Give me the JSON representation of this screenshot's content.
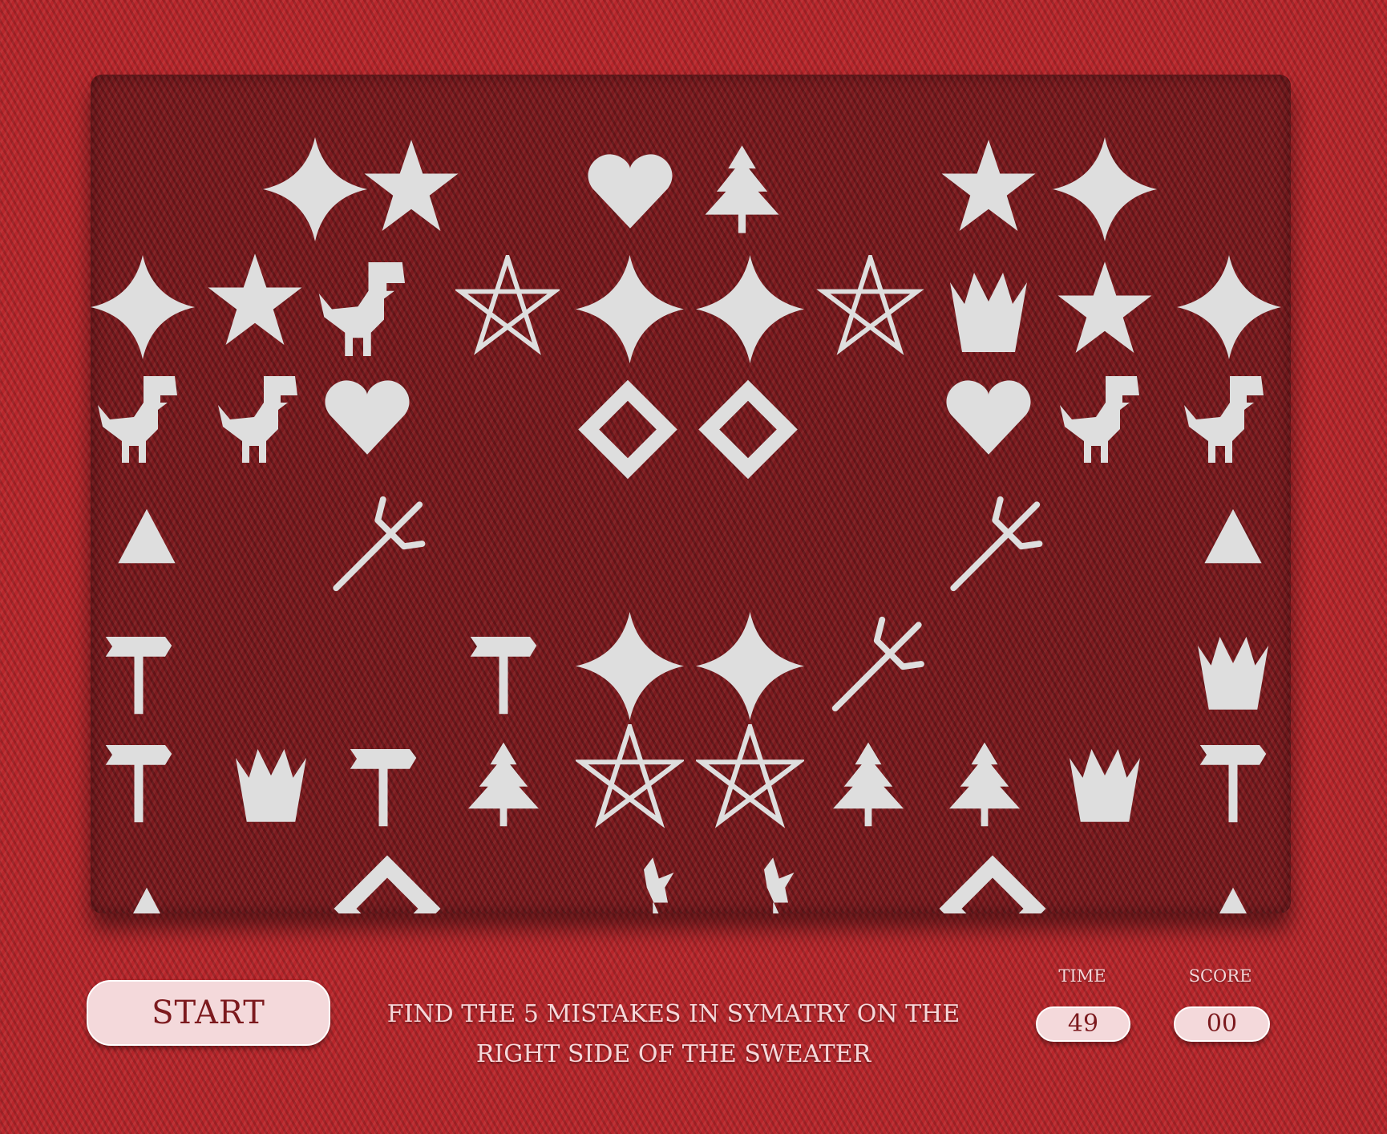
{
  "controls": {
    "start_label": "START"
  },
  "instructions": {
    "line1": "FIND THE 5 MISTAKES IN SYMATRY ON THE",
    "line2": "RIGHT SIDE OF THE SWEATER"
  },
  "stats": {
    "time_label": "TIME",
    "time_value": "49",
    "score_label": "SCORE",
    "score_value": "00"
  },
  "colors": {
    "background": "#b8262b",
    "board": "#7c1a1e",
    "motif": "#d9d9d9",
    "button": "#f4d9db",
    "text": "#f6d8da"
  },
  "motif_icons": [
    "star4-icon",
    "star5-icon",
    "heart-icon",
    "tree-icon",
    "star-outline-icon",
    "dinosaur-icon",
    "crown-icon",
    "diamond-icon",
    "trident-icon",
    "triangle-icon",
    "axe-icon",
    "reindeer-icon"
  ]
}
